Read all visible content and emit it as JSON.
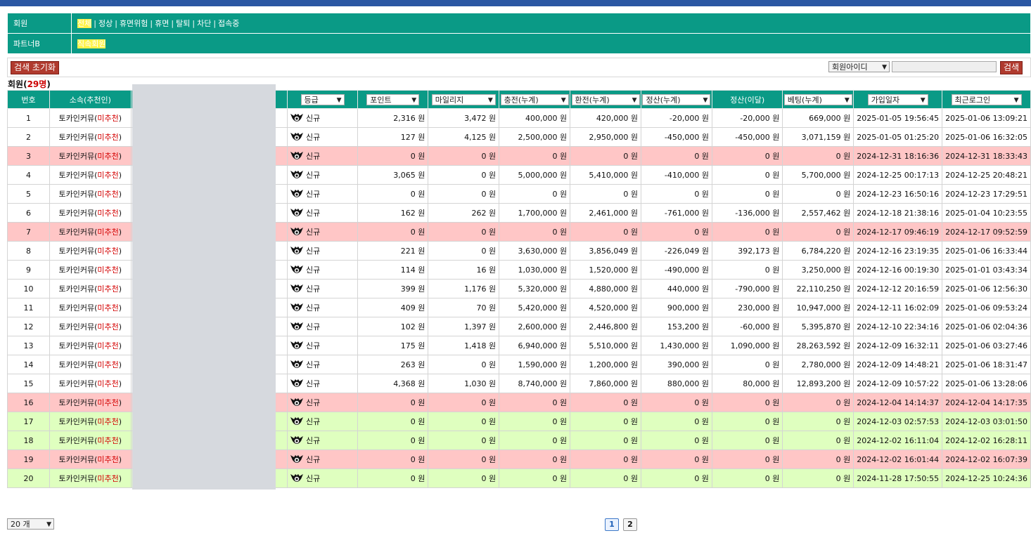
{
  "filters": {
    "member_label": "회원",
    "member_options": [
      "전체",
      "정상",
      "휴면위험",
      "휴면",
      "탈퇴",
      "차단",
      "접속중"
    ],
    "partner_label": "파트너B",
    "partner_value": "직속회원"
  },
  "search": {
    "reset_label": "검색 초기화",
    "field_select": "회원아이디",
    "input_value": "",
    "search_label": "검색"
  },
  "summary": {
    "prefix": "회원(",
    "count": "29명",
    "suffix": ")"
  },
  "table": {
    "headers": {
      "no": "번호",
      "affiliation": "소속(추천인)",
      "grade": "등급",
      "point": "포인트",
      "mileage": "마일리지",
      "deposit": "충전(누계)",
      "withdraw": "환전(누계)",
      "settle": "정산(누계)",
      "settle_month": "정산(이달)",
      "bet": "베팅(누계)",
      "joined": "가입일자",
      "last_login": "최근로그인"
    },
    "rows": [
      {
        "no": "1",
        "aff": "토카인커뮤",
        "rec": "미추천",
        "grade": "신규",
        "point": "2,316 원",
        "mileage": "3,472 원",
        "deposit": "400,000 원",
        "withdraw": "420,000 원",
        "settle": "-20,000 원",
        "settle_month": "-20,000 원",
        "bet": "669,000 원",
        "joined": "2025-01-05 19:56:45",
        "login": "2025-01-06 13:09:21",
        "style": "white"
      },
      {
        "no": "2",
        "aff": "토카인커뮤",
        "rec": "미추천",
        "grade": "신규",
        "point": "127 원",
        "mileage": "4,125 원",
        "deposit": "2,500,000 원",
        "withdraw": "2,950,000 원",
        "settle": "-450,000 원",
        "settle_month": "-450,000 원",
        "bet": "3,071,159 원",
        "joined": "2025-01-05 01:25:20",
        "login": "2025-01-06 16:32:05",
        "style": "white"
      },
      {
        "no": "3",
        "aff": "토카인커뮤",
        "rec": "미추천",
        "grade": "신규",
        "point": "0 원",
        "mileage": "0 원",
        "deposit": "0 원",
        "withdraw": "0 원",
        "settle": "0 원",
        "settle_month": "0 원",
        "bet": "0 원",
        "joined": "2024-12-31 18:16:36",
        "login": "2024-12-31 18:33:43",
        "style": "pink"
      },
      {
        "no": "4",
        "aff": "토카인커뮤",
        "rec": "미추천",
        "grade": "신규",
        "point": "3,065 원",
        "mileage": "0 원",
        "deposit": "5,000,000 원",
        "withdraw": "5,410,000 원",
        "settle": "-410,000 원",
        "settle_month": "0 원",
        "bet": "5,700,000 원",
        "joined": "2024-12-25 00:17:13",
        "login": "2024-12-25 20:48:21",
        "style": "white"
      },
      {
        "no": "5",
        "aff": "토카인커뮤",
        "rec": "미추천",
        "grade": "신규",
        "point": "0 원",
        "mileage": "0 원",
        "deposit": "0 원",
        "withdraw": "0 원",
        "settle": "0 원",
        "settle_month": "0 원",
        "bet": "0 원",
        "joined": "2024-12-23 16:50:16",
        "login": "2024-12-23 17:29:51",
        "style": "white"
      },
      {
        "no": "6",
        "aff": "토카인커뮤",
        "rec": "미추천",
        "grade": "신규",
        "point": "162 원",
        "mileage": "262 원",
        "deposit": "1,700,000 원",
        "withdraw": "2,461,000 원",
        "settle": "-761,000 원",
        "settle_month": "-136,000 원",
        "bet": "2,557,462 원",
        "joined": "2024-12-18 21:38:16",
        "login": "2025-01-04 10:23:55",
        "style": "white"
      },
      {
        "no": "7",
        "aff": "토카인커뮤",
        "rec": "미추천",
        "grade": "신규",
        "point": "0 원",
        "mileage": "0 원",
        "deposit": "0 원",
        "withdraw": "0 원",
        "settle": "0 원",
        "settle_month": "0 원",
        "bet": "0 원",
        "joined": "2024-12-17 09:46:19",
        "login": "2024-12-17 09:52:59",
        "style": "pink"
      },
      {
        "no": "8",
        "aff": "토카인커뮤",
        "rec": "미추천",
        "grade": "신규",
        "point": "221 원",
        "mileage": "0 원",
        "deposit": "3,630,000 원",
        "withdraw": "3,856,049 원",
        "settle": "-226,049 원",
        "settle_month": "392,173 원",
        "bet": "6,784,220 원",
        "joined": "2024-12-16 23:19:35",
        "login": "2025-01-06 16:33:44",
        "style": "white"
      },
      {
        "no": "9",
        "aff": "토카인커뮤",
        "rec": "미추천",
        "grade": "신규",
        "point": "114 원",
        "mileage": "16 원",
        "deposit": "1,030,000 원",
        "withdraw": "1,520,000 원",
        "settle": "-490,000 원",
        "settle_month": "0 원",
        "bet": "3,250,000 원",
        "joined": "2024-12-16 00:19:30",
        "login": "2025-01-01 03:43:34",
        "style": "white"
      },
      {
        "no": "10",
        "aff": "토카인커뮤",
        "rec": "미추천",
        "grade": "신규",
        "point": "399 원",
        "mileage": "1,176 원",
        "deposit": "5,320,000 원",
        "withdraw": "4,880,000 원",
        "settle": "440,000 원",
        "settle_month": "-790,000 원",
        "bet": "22,110,250 원",
        "joined": "2024-12-12 20:16:59",
        "login": "2025-01-06 12:56:30",
        "style": "white"
      },
      {
        "no": "11",
        "aff": "토카인커뮤",
        "rec": "미추천",
        "grade": "신규",
        "point": "409 원",
        "mileage": "70 원",
        "deposit": "5,420,000 원",
        "withdraw": "4,520,000 원",
        "settle": "900,000 원",
        "settle_month": "230,000 원",
        "bet": "10,947,000 원",
        "joined": "2024-12-11 16:02:09",
        "login": "2025-01-06 09:53:24",
        "style": "white"
      },
      {
        "no": "12",
        "aff": "토카인커뮤",
        "rec": "미추천",
        "grade": "신규",
        "point": "102 원",
        "mileage": "1,397 원",
        "deposit": "2,600,000 원",
        "withdraw": "2,446,800 원",
        "settle": "153,200 원",
        "settle_month": "-60,000 원",
        "bet": "5,395,870 원",
        "joined": "2024-12-10 22:34:16",
        "login": "2025-01-06 02:04:36",
        "style": "white"
      },
      {
        "no": "13",
        "aff": "토카인커뮤",
        "rec": "미추천",
        "grade": "신규",
        "point": "175 원",
        "mileage": "1,418 원",
        "deposit": "6,940,000 원",
        "withdraw": "5,510,000 원",
        "settle": "1,430,000 원",
        "settle_month": "1,090,000 원",
        "bet": "28,263,592 원",
        "joined": "2024-12-09 16:32:11",
        "login": "2025-01-06 03:27:46",
        "style": "white"
      },
      {
        "no": "14",
        "aff": "토카인커뮤",
        "rec": "미추천",
        "grade": "신규",
        "point": "263 원",
        "mileage": "0 원",
        "deposit": "1,590,000 원",
        "withdraw": "1,200,000 원",
        "settle": "390,000 원",
        "settle_month": "0 원",
        "bet": "2,780,000 원",
        "joined": "2024-12-09 14:48:21",
        "login": "2025-01-06 18:31:47",
        "style": "white"
      },
      {
        "no": "15",
        "aff": "토카인커뮤",
        "rec": "미추천",
        "grade": "신규",
        "point": "4,368 원",
        "mileage": "1,030 원",
        "deposit": "8,740,000 원",
        "withdraw": "7,860,000 원",
        "settle": "880,000 원",
        "settle_month": "80,000 원",
        "bet": "12,893,200 원",
        "joined": "2024-12-09 10:57:22",
        "login": "2025-01-06 13:28:06",
        "style": "white"
      },
      {
        "no": "16",
        "aff": "토카인커뮤",
        "rec": "미추천",
        "grade": "신규",
        "point": "0 원",
        "mileage": "0 원",
        "deposit": "0 원",
        "withdraw": "0 원",
        "settle": "0 원",
        "settle_month": "0 원",
        "bet": "0 원",
        "joined": "2024-12-04 14:14:37",
        "login": "2024-12-04 14:17:35",
        "style": "pink"
      },
      {
        "no": "17",
        "aff": "토카인커뮤",
        "rec": "미추천",
        "grade": "신규",
        "point": "0 원",
        "mileage": "0 원",
        "deposit": "0 원",
        "withdraw": "0 원",
        "settle": "0 원",
        "settle_month": "0 원",
        "bet": "0 원",
        "joined": "2024-12-03 02:57:53",
        "login": "2024-12-03 03:01:50",
        "style": "green"
      },
      {
        "no": "18",
        "aff": "토카인커뮤",
        "rec": "미추천",
        "grade": "신규",
        "point": "0 원",
        "mileage": "0 원",
        "deposit": "0 원",
        "withdraw": "0 원",
        "settle": "0 원",
        "settle_month": "0 원",
        "bet": "0 원",
        "joined": "2024-12-02 16:11:04",
        "login": "2024-12-02 16:28:11",
        "style": "green"
      },
      {
        "no": "19",
        "aff": "토카인커뮤",
        "rec": "미추천",
        "grade": "신규",
        "point": "0 원",
        "mileage": "0 원",
        "deposit": "0 원",
        "withdraw": "0 원",
        "settle": "0 원",
        "settle_month": "0 원",
        "bet": "0 원",
        "joined": "2024-12-02 16:01:44",
        "login": "2024-12-02 16:07:39",
        "style": "pink"
      },
      {
        "no": "20",
        "aff": "토카인커뮤",
        "rec": "미추천",
        "grade": "신규",
        "point": "0 원",
        "mileage": "0 원",
        "deposit": "0 원",
        "withdraw": "0 원",
        "settle": "0 원",
        "settle_month": "0 원",
        "bet": "0 원",
        "joined": "2024-11-28 17:50:55",
        "login": "2024-12-25 10:24:36",
        "style": "green"
      }
    ]
  },
  "footer": {
    "page_size": "20 개",
    "pages": [
      "1",
      "2"
    ],
    "current_page": "1"
  },
  "colors": {
    "header_teal": "#0a9a86",
    "top_bar_blue": "#2b57a3",
    "row_pink": "#ffc6c6",
    "row_green": "#dfffbf",
    "accent_red": "#b03a2e"
  }
}
